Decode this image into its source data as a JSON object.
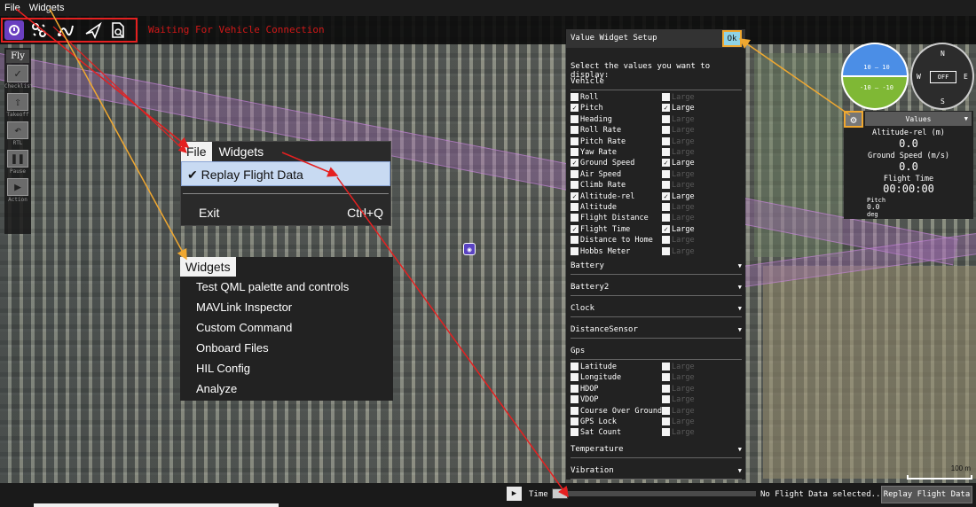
{
  "menubar": {
    "file": "File",
    "widgets": "Widgets"
  },
  "toolbar": {
    "connection_status": "Waiting For Vehicle Connection",
    "icons": [
      "qgc-logo-icon",
      "plan-icon",
      "waypoint-route-icon",
      "send-mission-icon",
      "document-analyze-icon"
    ]
  },
  "fly": {
    "label": "Fly",
    "buttons": [
      {
        "label": "Checklist"
      },
      {
        "label": "Takeoff"
      },
      {
        "label": "RTL"
      },
      {
        "label": "Pause"
      },
      {
        "label": "Action"
      }
    ]
  },
  "file_menu": {
    "header_file": "File",
    "header_widgets": "Widgets",
    "replay": "Replay Flight Data",
    "exit": "Exit",
    "exit_shortcut": "Ctrl+Q",
    "check": "✔"
  },
  "widgets_menu": {
    "header": "Widgets",
    "items": [
      "Test QML palette and controls",
      "MAVLink Inspector",
      "Custom Command",
      "Onboard Files",
      "HIL Config",
      "Analyze"
    ]
  },
  "value_setup": {
    "title": "Value Widget Setup",
    "ok": "Ok",
    "prompt": "Select the values you want to display:",
    "large_label": "Large",
    "vehicle_section": "Vehicle",
    "vehicle": [
      {
        "name": "Roll",
        "checked": false,
        "large": false
      },
      {
        "name": "Pitch",
        "checked": true,
        "large": true
      },
      {
        "name": "Heading",
        "checked": false,
        "large": false
      },
      {
        "name": "Roll Rate",
        "checked": false,
        "large": false
      },
      {
        "name": "Pitch Rate",
        "checked": false,
        "large": false
      },
      {
        "name": "Yaw Rate",
        "checked": false,
        "large": false
      },
      {
        "name": "Ground Speed",
        "checked": true,
        "large": true
      },
      {
        "name": "Air Speed",
        "checked": false,
        "large": false
      },
      {
        "name": "Climb Rate",
        "checked": false,
        "large": false
      },
      {
        "name": "Altitude-rel",
        "checked": true,
        "large": true
      },
      {
        "name": "Altitude",
        "checked": false,
        "large": false
      },
      {
        "name": "Flight Distance",
        "checked": false,
        "large": false
      },
      {
        "name": "Flight Time",
        "checked": true,
        "large": true
      },
      {
        "name": "Distance to Home",
        "checked": false,
        "large": false
      },
      {
        "name": "Hobbs Meter",
        "checked": false,
        "large": false
      }
    ],
    "collapsed_sections": [
      "Battery",
      "Battery2",
      "Clock",
      "DistanceSensor"
    ],
    "gps_section": "Gps",
    "gps": [
      {
        "name": "Latitude",
        "checked": false,
        "large": false
      },
      {
        "name": "Longitude",
        "checked": false,
        "large": false
      },
      {
        "name": "HDOP",
        "checked": false,
        "large": false
      },
      {
        "name": "VDOP",
        "checked": false,
        "large": false
      },
      {
        "name": "Course Over Ground",
        "checked": false,
        "large": false
      },
      {
        "name": "GPS Lock",
        "checked": false,
        "large": false
      },
      {
        "name": "Sat Count",
        "checked": false,
        "large": false
      }
    ],
    "tail_sections": [
      "Temperature",
      "Vibration"
    ]
  },
  "instruments": {
    "attitude_pitch_up": "10 — 10",
    "attitude_pitch_down": "-10 — -10",
    "compass": {
      "n": "N",
      "s": "S",
      "e": "E",
      "w": "W",
      "status": "OFF"
    }
  },
  "values_panel": {
    "selector": "Values",
    "items": [
      {
        "label": "Altitude-rel (m)",
        "value": "0.0"
      },
      {
        "label": "Ground Speed (m/s)",
        "value": "0.0"
      },
      {
        "label": "Flight Time",
        "value": "00:00:00"
      }
    ],
    "pitch": {
      "label": "Pitch",
      "value": "0.0",
      "unit": "deg"
    }
  },
  "bottombar": {
    "time_label": "Time",
    "status": "No Flight Data selected..",
    "replay_button": "Replay Flight Data",
    "play": "▶"
  },
  "map": {
    "scale": "100 m"
  },
  "colors": {
    "highlight_red": "#e52020",
    "highlight_orange": "#f0a830",
    "status_red": "#d01818",
    "ok_blue": "#8fd3e6",
    "qgc_purple": "#6a3fc0"
  }
}
